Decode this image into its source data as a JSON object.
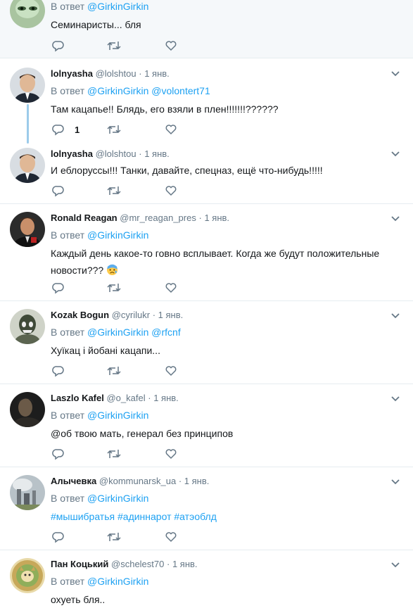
{
  "reply_prefix": "В ответ",
  "tweets": [
    {
      "name": "",
      "handle": "",
      "date": "",
      "reply_to": [
        "@GirkinGirkin"
      ],
      "text": "Семинаристы... бля",
      "reply_count": "",
      "highlighted": true
    },
    {
      "name": "lolnyasha",
      "handle": "@lolshtou",
      "date": "1 янв.",
      "reply_to": [
        "@GirkinGirkin",
        "@volontert71"
      ],
      "text": "Там кацапье!! Блядь, его взяли в плен!!!!!!!??????",
      "reply_count": "1"
    },
    {
      "name": "lolnyasha",
      "handle": "@lolshtou",
      "date": "1 янв.",
      "reply_to": [],
      "text": "И еблоруссы!!! Танки, давайте, спецназ, ещё что-нибудь!!!!!",
      "reply_count": ""
    },
    {
      "name": "Ronald Reagan",
      "handle": "@mr_reagan_pres",
      "date": "1 янв.",
      "reply_to": [
        "@GirkinGirkin"
      ],
      "text": "Каждый день какое-то говно всплывает. Когда же будут положительные",
      "text2": "новости???",
      "emoji": "anxious-face-emoji",
      "reply_count": ""
    },
    {
      "name": "Kozak Bogun",
      "handle": "@cyrilukr",
      "date": "1 янв.",
      "reply_to": [
        "@GirkinGirkin",
        "@rfcnf"
      ],
      "text": "Хуїкац і йобані кацапи...",
      "reply_count": ""
    },
    {
      "name": "Laszlo Kafel",
      "handle": "@o_kafel",
      "date": "1 янв.",
      "reply_to": [
        "@GirkinGirkin"
      ],
      "text": "@об твою мать, генерал без принципов",
      "reply_count": ""
    },
    {
      "name": "Алычевка",
      "handle": "@kommunarsk_ua",
      "date": "1 янв.",
      "reply_to": [
        "@GirkinGirkin"
      ],
      "hashtags": [
        "#мышибратья",
        "#адиннарот",
        "#атэоблд"
      ],
      "reply_count": ""
    },
    {
      "name": "Пан Коцький",
      "handle": "@schelest70",
      "date": "1 янв.",
      "reply_to": [
        "@GirkinGirkin"
      ],
      "text": "охуеть бля..",
      "reply_count": ""
    }
  ],
  "colors": {
    "link": "#1da1f2",
    "muted": "#657786",
    "text": "#14171a",
    "divider": "#e6ecf0",
    "thread_line": "#9ccbea"
  },
  "icons": [
    "reply-icon",
    "retweet-icon",
    "like-icon",
    "chevron-down-icon"
  ]
}
